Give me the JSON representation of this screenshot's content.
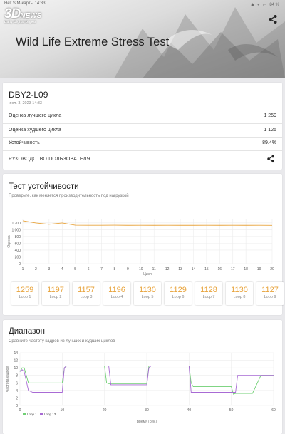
{
  "status_bar": {
    "carrier": "Нет SIM-карты 14:33",
    "battery": "84 %"
  },
  "logo": {
    "big": "3D",
    "small": "NEWS",
    "tagline": "Daily Digital Digest"
  },
  "hero": {
    "title": "Wild Life Extreme Stress Test"
  },
  "result": {
    "device": "DBY2-L09",
    "date": "июл. 3, 2023 14:33",
    "rows": [
      {
        "label": "Оценка лучшего цикла",
        "value": "1 259"
      },
      {
        "label": "Оценка худшего цикла",
        "value": "1 125"
      },
      {
        "label": "Устойчивость",
        "value": "89.4%"
      }
    ],
    "manual_label": "РУКОВОДСТВО ПОЛЬЗОВАТЕЛЯ"
  },
  "stability": {
    "title": "Тест устойчивости",
    "subtitle": "Проверьте, как меняется производительность под нагрузкой",
    "loops": [
      {
        "value": "1259",
        "label": "Loop 1"
      },
      {
        "value": "1197",
        "label": "Loop 2"
      },
      {
        "value": "1157",
        "label": "Loop 3"
      },
      {
        "value": "1196",
        "label": "Loop 4"
      },
      {
        "value": "1130",
        "label": "Loop 5"
      },
      {
        "value": "1129",
        "label": "Loop 6"
      },
      {
        "value": "1128",
        "label": "Loop 7"
      },
      {
        "value": "1130",
        "label": "Loop 8"
      },
      {
        "value": "1127",
        "label": "Loop 9"
      }
    ]
  },
  "range": {
    "title": "Диапазон",
    "subtitle": "Сравните частоту кадров из лучших и худших циклов"
  },
  "chart_data": [
    {
      "type": "line",
      "xlabel": "Цикл",
      "ylabel": "Оценка",
      "ylim": [
        0,
        1300
      ],
      "yticks": [
        "0",
        "200",
        "400",
        "600",
        "800",
        "1 000",
        "1 200"
      ],
      "x": [
        1,
        2,
        3,
        4,
        5,
        6,
        7,
        8,
        9,
        10,
        11,
        12,
        13,
        14,
        15,
        16,
        17,
        18,
        19,
        20
      ],
      "series": [
        {
          "values": [
            1259,
            1197,
            1157,
            1196,
            1130,
            1129,
            1128,
            1130,
            1127,
            1128,
            1127,
            1128,
            1127,
            1127,
            1128,
            1127,
            1128,
            1127,
            1128,
            1125
          ],
          "color": "#e8a33b"
        }
      ],
      "grid": true
    },
    {
      "type": "line",
      "xlabel": "Время (сек.)",
      "ylabel": "Частота кадров",
      "xlim": [
        0,
        60
      ],
      "ylim": [
        0,
        14
      ],
      "xticks": [
        "0",
        "10",
        "20",
        "30",
        "40",
        "50",
        "60"
      ],
      "yticks": [
        "0",
        "2",
        "4",
        "6",
        "8",
        "10",
        "12",
        "14"
      ],
      "grid": true,
      "legend": "bottom-left",
      "series": [
        {
          "name": "Loop 1",
          "color": "#6fcf73",
          "x": [
            0,
            0.5,
            1,
            2,
            3,
            4,
            5,
            6,
            7,
            8,
            9,
            10,
            10.5,
            11,
            13,
            15,
            17,
            19,
            20,
            20.5,
            21,
            23,
            25,
            27,
            29,
            30,
            30.5,
            31,
            33,
            35,
            37,
            39,
            40,
            40.5,
            41,
            43,
            45,
            47,
            49,
            50,
            50.5,
            51,
            53,
            55,
            57,
            59,
            60
          ],
          "y": [
            9,
            10,
            10,
            6,
            6,
            6,
            6,
            6,
            6,
            6,
            6,
            6,
            10,
            10.5,
            10.5,
            10.5,
            10.5,
            10.5,
            10.5,
            6,
            5.8,
            5.8,
            5.8,
            5.8,
            5.8,
            5.8,
            10.5,
            10.5,
            10.5,
            10.5,
            10.5,
            10.5,
            10.5,
            6,
            5,
            5,
            5,
            5,
            5,
            5,
            3,
            3.2,
            3.2,
            3.2,
            8,
            8,
            8
          ]
        },
        {
          "name": "Loop 13",
          "color": "#a86ad4",
          "x": [
            0,
            0.5,
            1,
            2,
            3,
            4,
            5,
            6,
            7,
            8,
            9,
            10,
            10.5,
            11,
            13,
            15,
            17,
            19,
            21,
            21.5,
            22,
            24,
            26,
            28,
            30,
            30.5,
            31,
            33,
            35,
            37,
            39,
            40,
            40.5,
            41,
            43,
            45,
            47,
            49,
            51,
            51.5,
            52,
            54,
            56,
            58,
            60
          ],
          "y": [
            9,
            9.5,
            9,
            4,
            3.5,
            3.5,
            3.5,
            3.5,
            3.5,
            3.5,
            3.5,
            3.5,
            10,
            10.5,
            10.5,
            10.5,
            10.5,
            10.5,
            10.5,
            5.5,
            5.5,
            5.5,
            5.5,
            5.5,
            5.5,
            10,
            10.5,
            10.5,
            10.5,
            10.5,
            10.5,
            10.5,
            3.5,
            3.5,
            3.5,
            3.5,
            3.5,
            3.5,
            3.5,
            8,
            8,
            8,
            8,
            8,
            8
          ]
        }
      ]
    }
  ]
}
